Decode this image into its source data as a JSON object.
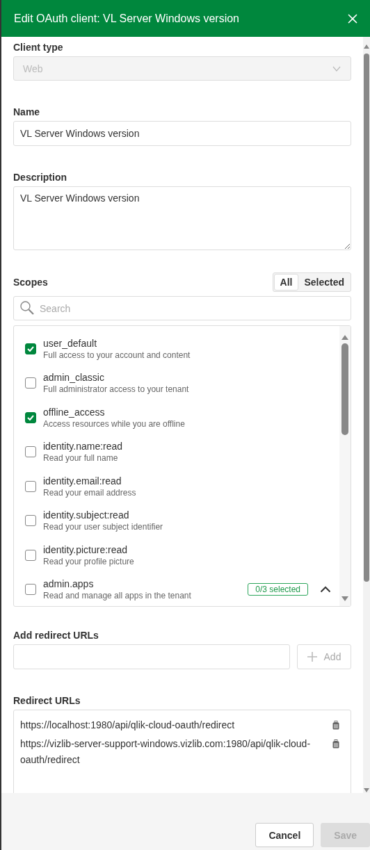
{
  "dialog": {
    "title": "Edit OAuth client: VL Server Windows version"
  },
  "client_type": {
    "label": "Client type",
    "value": "Web",
    "disabled": true
  },
  "name": {
    "label": "Name",
    "value": "VL Server Windows version"
  },
  "description": {
    "label": "Description",
    "value": "VL Server Windows version"
  },
  "scopes": {
    "label": "Scopes",
    "filters": [
      {
        "label": "All",
        "selected": true
      },
      {
        "label": "Selected",
        "selected": false
      }
    ],
    "search": {
      "placeholder": "Search"
    },
    "items": [
      {
        "name": "user_default",
        "description": "Full access to your account and content",
        "checked": true
      },
      {
        "name": "admin_classic",
        "description": "Full administrator access to your tenant",
        "checked": false
      },
      {
        "name": "offline_access",
        "description": "Access resources while you are offline",
        "checked": true
      },
      {
        "name": "identity.name:read",
        "description": "Read your full name",
        "checked": false
      },
      {
        "name": "identity.email:read",
        "description": "Read your email address",
        "checked": false
      },
      {
        "name": "identity.subject:read",
        "description": "Read your user subject identifier",
        "checked": false
      },
      {
        "name": "identity.picture:read",
        "description": "Read your profile picture",
        "checked": false
      },
      {
        "name": "admin.apps",
        "description": "Read and manage all apps in the tenant",
        "checked": false,
        "badge": "0/3 selected",
        "expanded": true
      }
    ]
  },
  "add_redirect": {
    "label": "Add redirect URLs",
    "button": "Add",
    "disabled": true
  },
  "redirect_urls": {
    "label": "Redirect URLs",
    "items": [
      "https://localhost:1980/api/qlik-cloud-oauth/redirect",
      "https://vizlib-server-support-windows.vizlib.com:1980/api/qlik-cloud-oauth/redirect"
    ]
  },
  "buttons": [
    {
      "label": "Cancel",
      "disabled": false
    },
    {
      "label": "Save",
      "disabled": true
    }
  ]
}
